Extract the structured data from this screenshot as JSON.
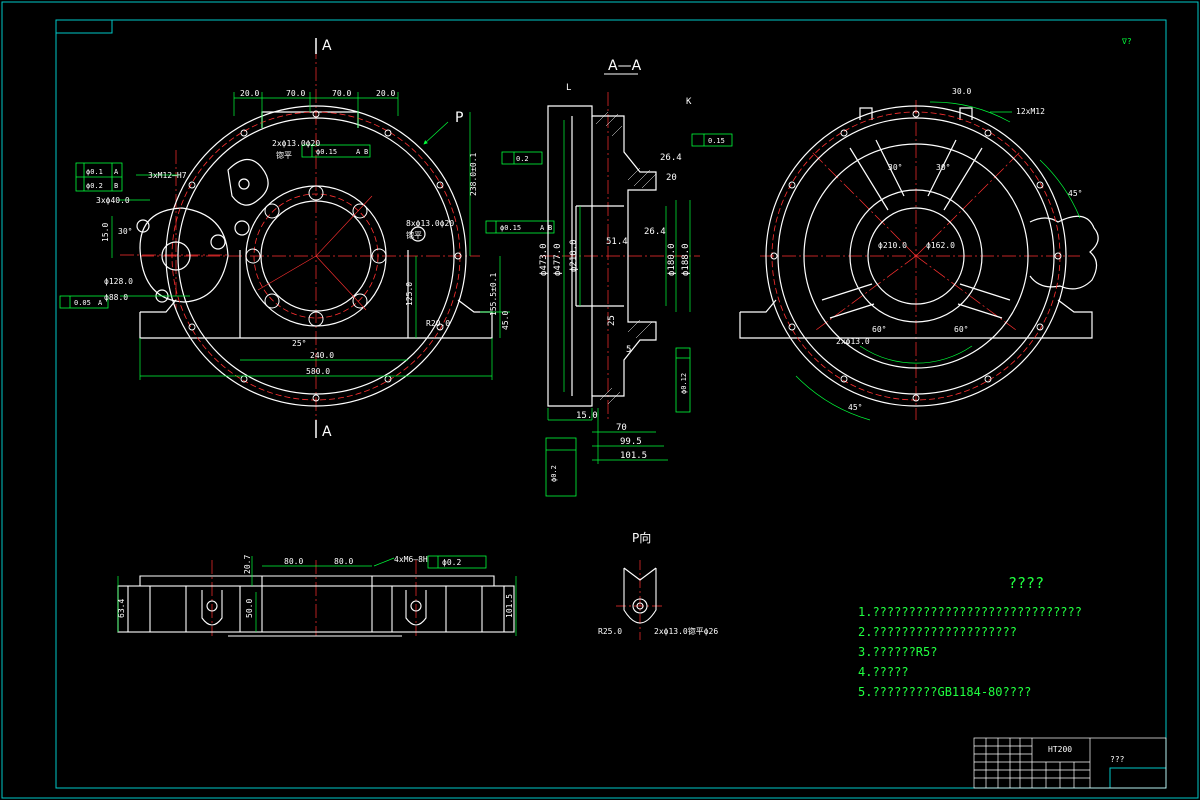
{
  "colors": {
    "border": "#00c8c8",
    "white": "#ffffff",
    "red": "#ff3030",
    "green": "#00ff3a",
    "cyan": "#00e5e5",
    "note": "#20ff40"
  },
  "views": {
    "front_label_top": "A",
    "front_label_bottom": "A",
    "section_title": "A—A",
    "arrow_label": "P",
    "p_view_title": "P向"
  },
  "front_dims": {
    "d20a": "20.0",
    "d70a": "70.0",
    "d70b": "70.0",
    "d20b": "20.0",
    "d240": "240.0",
    "d580": "580.0",
    "d238": "238.0±0.1",
    "d125": "125.0",
    "d155": "155.5±0.1",
    "d45": "45.0",
    "r20": "R20.0",
    "d128": "ϕ128.0",
    "d88": "ϕ88.0",
    "d15": "15.0",
    "a30": "30°",
    "a25": "25°",
    "h4m12": "3xM12–H7",
    "h3x40": "3xϕ40.0",
    "h2x13": "2xϕ13.0ϕ20",
    "h8x13": "8xϕ13.0ϕ20",
    "flat1": "锪平",
    "flat2": "锪平",
    "tol1": "ϕ0.1",
    "tol2": "ϕ0.2",
    "tol3": "ϕ0.15",
    "tol4": "ϕ0.15",
    "tol5": "0.05",
    "ref_a": "A",
    "ref_b": "B",
    "ref_c": "C"
  },
  "section_dims": {
    "L": "L",
    "K": "K",
    "d15": "15.0",
    "d70": "70",
    "d995": "99.5",
    "d1015": "101.5",
    "d264a": "26.4",
    "d264b": "26.4",
    "d20": "20",
    "d514": "51.4",
    "d210": "ϕ210.0",
    "d473": "ϕ473.0",
    "d477": "ϕ477.0",
    "d180": "ϕ180.0",
    "d188": "ϕ188.0",
    "tol1": "0.2",
    "tol2": "0.15",
    "tol3": "ϕ0.2",
    "tol4": "ϕ0.12",
    "d5": "5",
    "d25": "25"
  },
  "right_dims": {
    "d12m12": "12xM12",
    "d2x13": "2xϕ13.0",
    "a45a": "45°",
    "a45b": "45°",
    "a30a": "30°",
    "a30b": "30°",
    "a60a": "60°",
    "a60b": "60°",
    "d210": "ϕ210.0",
    "d162": "ϕ162.0",
    "d30": "30.0"
  },
  "bottom_dims": {
    "d80a": "80.0",
    "d80b": "80.0",
    "d207": "20.7",
    "d50": "50.0",
    "d634": "63.4",
    "d1015": "101.5",
    "hole": "4xM6–8H",
    "tol": "ϕ0.2"
  },
  "p_view": {
    "r25": "R25.0",
    "hole": "2xϕ13.0锪平ϕ26"
  },
  "notes": {
    "title": "????",
    "n1": "1.?????????????????????????????",
    "n2": "2.????????????????????",
    "n3": "3.??????R5?",
    "n4": "4.?????",
    "n5": "5.?????????GB1184-80????"
  },
  "titleblock": {
    "material": "HT200",
    "mark": "???"
  },
  "corner_mark": "∇?"
}
